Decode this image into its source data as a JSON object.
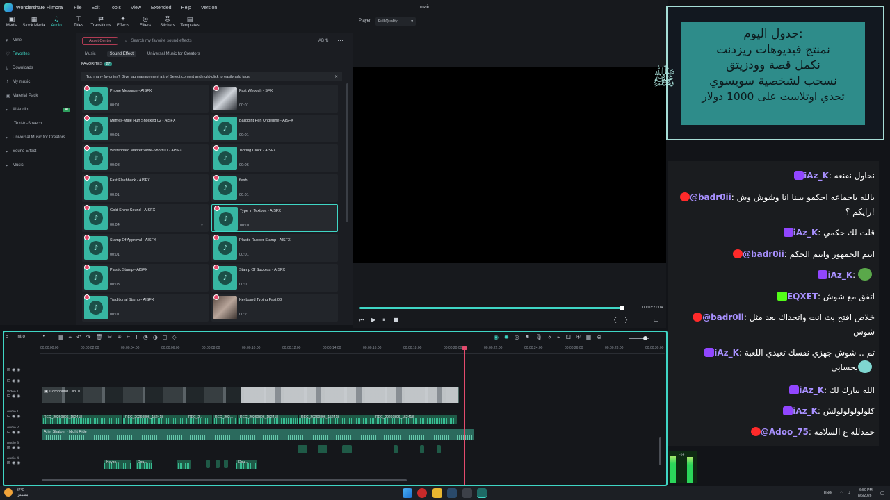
{
  "app": {
    "name": "Wondershare Filmora",
    "doc_title": "main",
    "menu": [
      "File",
      "Edit",
      "Tools",
      "View",
      "Extended",
      "Help",
      "Version"
    ]
  },
  "toolbar": [
    {
      "label": "Media",
      "icon": "media-icon",
      "ic": "▣"
    },
    {
      "label": "Stock Media",
      "icon": "stock-media-icon",
      "ic": "▦"
    },
    {
      "label": "Audio",
      "icon": "audio-icon",
      "ic": "♫",
      "active": true
    },
    {
      "label": "Titles",
      "icon": "titles-icon",
      "ic": "T"
    },
    {
      "label": "Transitions",
      "icon": "transitions-icon",
      "ic": "⇄"
    },
    {
      "label": "Effects",
      "icon": "effects-icon",
      "ic": "✦"
    },
    {
      "label": "Filters",
      "icon": "filters-icon",
      "ic": "◎"
    },
    {
      "label": "Stickers",
      "icon": "stickers-icon",
      "ic": "☺"
    },
    {
      "label": "Templates",
      "icon": "templates-icon",
      "ic": "▤"
    }
  ],
  "leftnav": [
    {
      "label": "Mine",
      "icon": "chevron-down-icon",
      "ic": "▾"
    },
    {
      "label": "Favorites",
      "icon": "heart-icon",
      "ic": "♡",
      "active": true
    },
    {
      "label": "Downloads",
      "icon": "download-icon",
      "ic": "⤓"
    },
    {
      "label": "My music",
      "icon": "music-folder-icon",
      "ic": "♪"
    },
    {
      "label": "Material Pack",
      "icon": "package-icon",
      "ic": "▣"
    },
    {
      "label": "AI Audio",
      "icon": "chevron-right-icon",
      "ic": "▸",
      "badge": "AI"
    },
    {
      "label": "Text-to-Speech",
      "icon": "",
      "ic": ""
    },
    {
      "label": "Universal Music for Creators",
      "icon": "chevron-right-icon",
      "ic": "▸"
    },
    {
      "label": "Sound Effect",
      "icon": "chevron-right-icon",
      "ic": "▸"
    },
    {
      "label": "Music",
      "icon": "chevron-right-icon",
      "ic": "▸"
    }
  ],
  "content": {
    "asset_center": "Asset Center",
    "search_placeholder": "Search my favorite sound effects",
    "subtabs": [
      "Music",
      "Sound Effect",
      "Universal Music for Creators"
    ],
    "active_subtab": 1,
    "favorites_label": "FAVORITES",
    "favorites_count": "27",
    "notice": "Too many favorites? Give tag management a try! Select content and right-click to easily add tags.",
    "cards": [
      {
        "name": "Phone Message - AISFX",
        "dur": "00:01",
        "thumb": "disc"
      },
      {
        "name": "Fast Whoosh - SFX",
        "dur": "00:01",
        "thumb": "img"
      },
      {
        "name": "Memes-Male Huh Shocked 02 - AISFX",
        "dur": "00:01",
        "thumb": "disc"
      },
      {
        "name": "Ballpoint Pen Underline - AISFX",
        "dur": "00:01",
        "thumb": "disc"
      },
      {
        "name": "Whiteboard Marker Write-Short 01 - AISFX",
        "dur": "00:03",
        "thumb": "disc"
      },
      {
        "name": "Ticking Clock - AISFX",
        "dur": "00:06",
        "thumb": "disc"
      },
      {
        "name": "Fast Flashback - AISFX",
        "dur": "00:01",
        "thumb": "disc"
      },
      {
        "name": "flash",
        "dur": "00:01",
        "thumb": "disc"
      },
      {
        "name": "Gold Shine Sound - AISFX",
        "dur": "00:04",
        "thumb": "disc",
        "download": true
      },
      {
        "name": "Type In Textbox - AISFX",
        "dur": "00:01",
        "thumb": "disc",
        "selected": true
      },
      {
        "name": "Stamp Of Approval - AISFX",
        "dur": "00:01",
        "thumb": "disc"
      },
      {
        "name": "Plastic Rubber Stamp - AISFX",
        "dur": "00:01",
        "thumb": "disc"
      },
      {
        "name": "Plastic Stamp - AISFX",
        "dur": "00:03",
        "thumb": "disc"
      },
      {
        "name": "Stamp Of Success - AISFX",
        "dur": "00:01",
        "thumb": "disc"
      },
      {
        "name": "Traditional Stamp - AISFX",
        "dur": "00:01",
        "thumb": "disc"
      },
      {
        "name": "Keyboard Typing Fast 03",
        "dur": "00:21",
        "thumb": "img2"
      }
    ]
  },
  "player": {
    "label": "Player",
    "quality": "Full Quality",
    "time": "00:03:21:04",
    "progress": 0.995
  },
  "timeline": {
    "name": "Intro",
    "ruler": [
      "00:00:00:00",
      "00:00:02:00",
      "00:00:04:00",
      "00:00:06:00",
      "00:00:08:00",
      "00:00:10:00",
      "00:00:12:00",
      "00:00:14:00",
      "00:00:16:00",
      "00:00:18:00",
      "00:00:20:00",
      "00:00:22:00",
      "00:00:24:00",
      "00:00:26:00",
      "00:00:28:00",
      "00:00:30:00"
    ],
    "compound_clip": "Compound Clip 10",
    "audio_clips": [
      "REC_20260806_152418",
      "REC_20260806_152418",
      "REC_2...",
      "REC_202...",
      "REC_20260806_152418",
      "REC_20260806_152418",
      "REC_20260806_152418"
    ],
    "music_clip": "Ariel Shalom - Night Ride",
    "small_clips": [
      "Keybo...",
      "Dou...",
      "",
      "Dou..."
    ],
    "tracks": [
      "Video 1",
      "Audio 1",
      "Audio 2",
      "Audio 3",
      "Audio 4"
    ]
  },
  "schedule": {
    "lines": [
      "جدول اليوم:",
      "نمنتج فيديوهات ريزدنت",
      "نكمل قصة وودزيتق",
      "نسحب لشخصية سويسوي",
      "تحدي اوتلاست على 1000 دولار"
    ]
  },
  "chat": [
    {
      "platform": "twitch",
      "user": "iAz_K",
      "text": "نحاول نقنعه"
    },
    {
      "platform": "youtube",
      "user": "@badr0ii",
      "text": "بالله ياجماعه احكمو بيننا انا وشوش وش رايكم ؟!"
    },
    {
      "platform": "twitch",
      "user": "iAz_K",
      "text": "قلت لك حكمي"
    },
    {
      "platform": "youtube",
      "user": "@badr0ii",
      "text": "انتم الجمهور وانتم الحكم"
    },
    {
      "platform": "twitch",
      "user": "iAz_K",
      "text": "",
      "emote": "#5aa84a"
    },
    {
      "platform": "kick",
      "user": "EQXET",
      "text": "اتفق مع شوش"
    },
    {
      "platform": "youtube",
      "user": "@badr0ii",
      "text": "خلاص افتح بث انت واتحداك بعد مثل شوش"
    },
    {
      "platform": "twitch",
      "user": "iAz_K",
      "text": "تم .. شوش جهزي نفسك تعيدي اللعبة بحسابي",
      "emote": "#7fd6d0"
    },
    {
      "platform": "twitch",
      "user": "iAz_K",
      "text": "الله يبارك لك"
    },
    {
      "platform": "twitch",
      "user": "iAz_K",
      "text": "كلولولولولولش"
    },
    {
      "platform": "youtube",
      "user": "@Adoo_75",
      "text": "حمدلله ع السلامه"
    }
  ],
  "taskbar": {
    "weather_temp": "37°C",
    "weather_desc": "مشمس",
    "lang": "ENG",
    "time": "6:50 PM",
    "date": "8/6/2026"
  },
  "colors": {
    "accent": "#3fd6c5",
    "playhead": "#e34b6d",
    "twitch": "#9146ff",
    "youtube": "#ff2a2a",
    "kick": "#53fc18"
  }
}
